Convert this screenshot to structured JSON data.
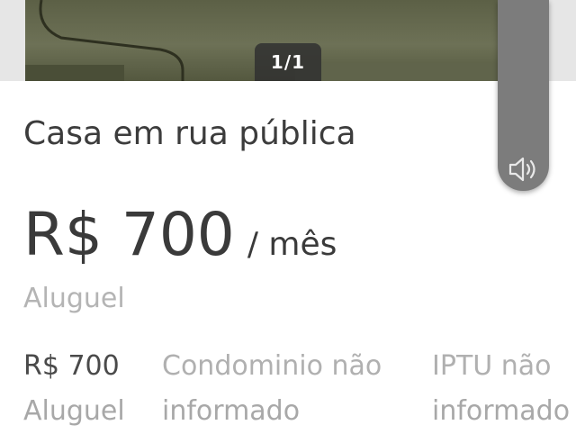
{
  "gallery": {
    "counter": "1/1"
  },
  "listing": {
    "title": "Casa em rua pública",
    "price": "R$ 700",
    "period": "/ mês",
    "price_type": "Aluguel"
  },
  "details": [
    {
      "main": "R$ 700",
      "sub": "Aluguel"
    },
    {
      "main": "Condominio não",
      "sub": "informado"
    },
    {
      "main": "IPTU não",
      "sub": "informado"
    }
  ],
  "icons": {
    "volume": "volume-icon"
  }
}
